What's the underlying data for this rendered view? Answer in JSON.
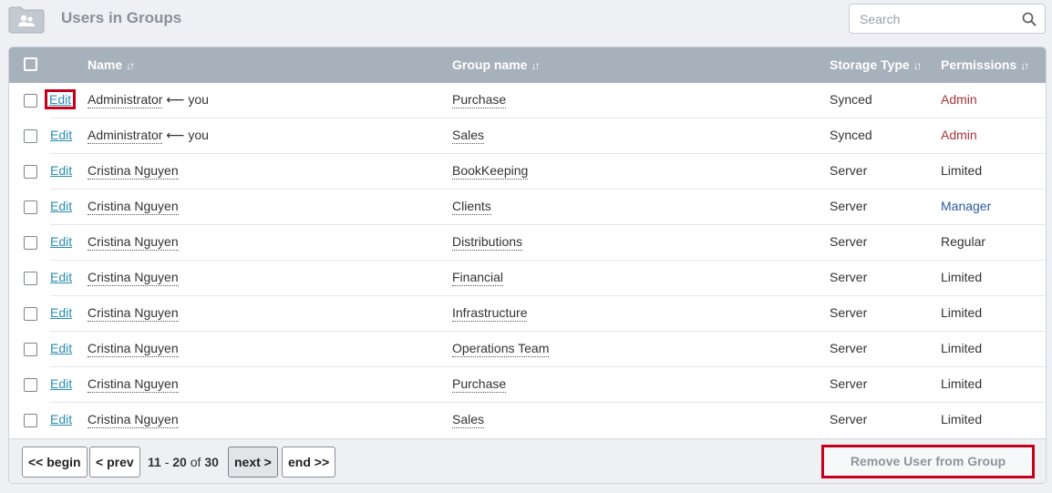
{
  "header": {
    "title": "Users in Groups",
    "search_placeholder": "Search",
    "folder_icon": "users-folder-icon",
    "search_icon": "search-icon"
  },
  "table": {
    "columns": {
      "name": "Name",
      "group": "Group name",
      "storage": "Storage Type",
      "permissions": "Permissions",
      "sort_glyph": "↓↑"
    },
    "edit_label": "Edit",
    "you_suffix": "⟵ you",
    "rows": [
      {
        "name": "Administrator",
        "you": true,
        "group": "Purchase",
        "storage": "Synced",
        "permission": "Admin",
        "perm_class": "admin"
      },
      {
        "name": "Administrator",
        "you": true,
        "group": "Sales",
        "storage": "Synced",
        "permission": "Admin",
        "perm_class": "admin"
      },
      {
        "name": "Cristina Nguyen",
        "you": false,
        "group": "BookKeeping",
        "storage": "Server",
        "permission": "Limited",
        "perm_class": ""
      },
      {
        "name": "Cristina Nguyen",
        "you": false,
        "group": "Clients",
        "storage": "Server",
        "permission": "Manager",
        "perm_class": "manager"
      },
      {
        "name": "Cristina Nguyen",
        "you": false,
        "group": "Distributions",
        "storage": "Server",
        "permission": "Regular",
        "perm_class": ""
      },
      {
        "name": "Cristina Nguyen",
        "you": false,
        "group": "Financial",
        "storage": "Server",
        "permission": "Limited",
        "perm_class": ""
      },
      {
        "name": "Cristina Nguyen",
        "you": false,
        "group": "Infrastructure",
        "storage": "Server",
        "permission": "Limited",
        "perm_class": ""
      },
      {
        "name": "Cristina Nguyen",
        "you": false,
        "group": "Operations Team",
        "storage": "Server",
        "permission": "Limited",
        "perm_class": ""
      },
      {
        "name": "Cristina Nguyen",
        "you": false,
        "group": "Purchase",
        "storage": "Server",
        "permission": "Limited",
        "perm_class": ""
      },
      {
        "name": "Cristina Nguyen",
        "you": false,
        "group": "Sales",
        "storage": "Server",
        "permission": "Limited",
        "perm_class": ""
      }
    ]
  },
  "pagination": {
    "begin_label": "<< begin",
    "prev_label": "< prev",
    "range_start": "11",
    "range_sep": " - ",
    "range_end": "20",
    "of_label": " of ",
    "total": "30",
    "next_label": "next >",
    "end_label": "end >>"
  },
  "actions": {
    "remove_label": "Remove User from Group"
  },
  "colors": {
    "header_bg": "#a7b1bb",
    "link": "#2a8db0",
    "admin": "#a8333a",
    "manager": "#2c5aa0",
    "highlight": "#c4001a"
  }
}
